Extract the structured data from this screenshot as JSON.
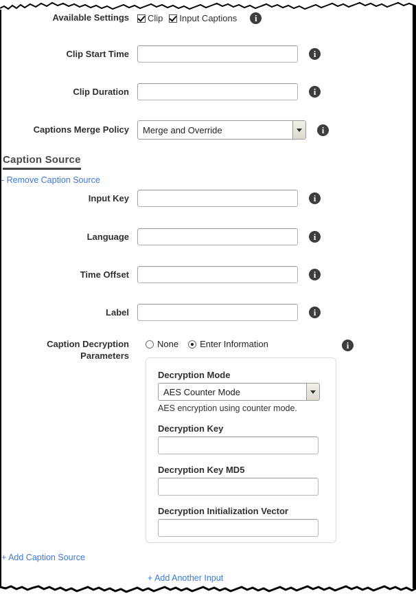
{
  "form": {
    "available_settings": {
      "label": "Available Settings",
      "checkboxes": [
        {
          "label": "Clip",
          "checked": true
        },
        {
          "label": "Input Captions",
          "checked": true
        }
      ]
    },
    "clip_start_time": {
      "label": "Clip Start Time",
      "value": ""
    },
    "clip_duration": {
      "label": "Clip Duration",
      "value": ""
    },
    "captions_merge_policy": {
      "label": "Captions Merge Policy",
      "value": "Merge and Override"
    }
  },
  "caption_source": {
    "heading": "Caption Source",
    "remove_link": "- Remove Caption Source",
    "input_key": {
      "label": "Input Key",
      "value": ""
    },
    "language": {
      "label": "Language",
      "value": ""
    },
    "time_offset": {
      "label": "Time Offset",
      "value": ""
    },
    "label_field": {
      "label": "Label",
      "value": ""
    },
    "decryption": {
      "label_line1": "Caption Decryption",
      "label_line2": "Parameters",
      "radios": [
        {
          "label": "None",
          "selected": false
        },
        {
          "label": "Enter Information",
          "selected": true
        }
      ],
      "mode": {
        "label": "Decryption Mode",
        "value": "AES Counter Mode",
        "hint": "AES encryption using counter mode."
      },
      "key": {
        "label": "Decryption Key",
        "value": ""
      },
      "key_md5": {
        "label": "Decryption Key MD5",
        "value": ""
      },
      "init_vector": {
        "label": "Decryption Initialization Vector",
        "value": ""
      }
    }
  },
  "footer": {
    "add_caption_source": "+ Add Caption Source",
    "add_another_input": "+ Add Another Input"
  },
  "icons": {
    "info": "i"
  },
  "colors": {
    "link": "#3b78d8",
    "label": "#303030",
    "heading": "#4a4a4a",
    "info_bg": "#3d3d3d"
  }
}
